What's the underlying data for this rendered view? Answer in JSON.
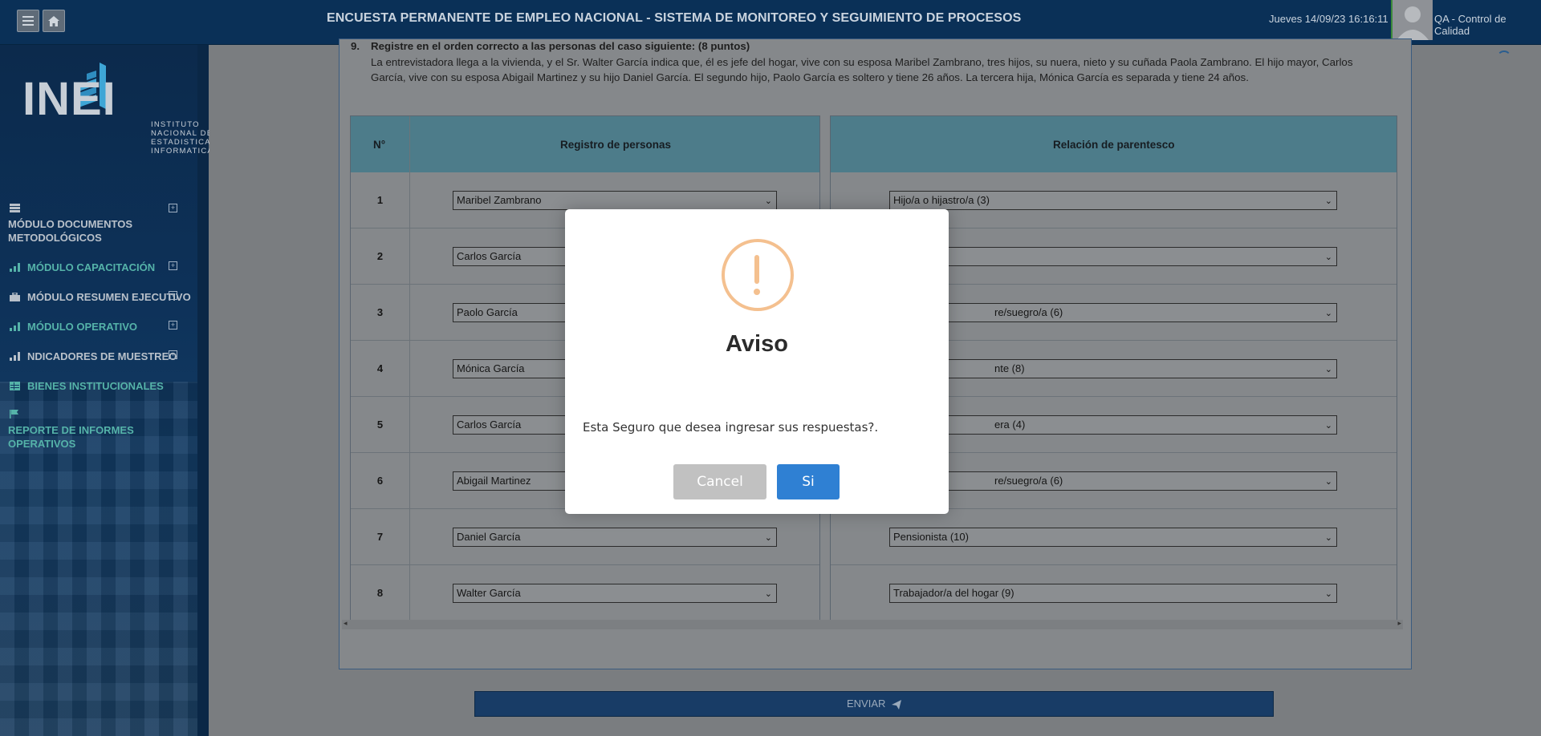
{
  "header": {
    "title": "ENCUESTA PERMANENTE DE EMPLEO NACIONAL - SISTEMA DE MONITOREO Y SEGUIMIENTO DE PROCESOS",
    "datetime": "Jueves 14/09/23 16:16:11",
    "user": "QA - Control de Calidad",
    "menu_icon": "hamburger-icon",
    "home_icon": "home-icon"
  },
  "logo": {
    "word": "INEI",
    "sub": [
      "INSTITUTO",
      "NACIONAL DE",
      "ESTADISTICA E",
      "INFORMATICA"
    ]
  },
  "sidebar": {
    "items": [
      {
        "label_line1": "MÓDULO DOCUMENTOS",
        "label_line2": "METODOLÓGICOS",
        "icon": "database-icon"
      },
      {
        "label": "MÓDULO CAPACITACIÓN",
        "icon": "bar-chart-icon"
      },
      {
        "label": "MÓDULO RESUMEN EJECUTIVO",
        "icon": "briefcase-icon"
      },
      {
        "label": "MÓDULO OPERATIVO",
        "icon": "bar-chart-icon"
      },
      {
        "label": "NDICADORES DE MUESTREO",
        "icon": "bar-chart-icon"
      },
      {
        "label": "BIENES INSTITUCIONALES",
        "icon": "table-icon"
      },
      {
        "label_line1": "REPORTE DE INFORMES",
        "label_line2": "OPERATIVOS",
        "icon": "flag-icon"
      }
    ]
  },
  "question": {
    "number": "9.",
    "title": "Registre en el orden correcto a las personas del caso siguiente: (8 puntos)",
    "body": "La entrevistadora llega a la vivienda, y el Sr. Walter García indica que, él es jefe del hogar, vive con su esposa Maribel Zambrano, tres hijos, su nuera, nieto y su cuñada Paola Zambrano. El hijo mayor, Carlos García, vive con su esposa Abigail Martinez y su hijo Daniel García. El segundo hijo, Paolo García es soltero y tiene 26 años. La tercera hija, Mónica García es separada y tiene 24 años."
  },
  "table_left": {
    "col_num": "N°",
    "col_name": "Registro de personas",
    "rows": [
      {
        "n": "1",
        "value": "Maribel Zambrano"
      },
      {
        "n": "2",
        "value": "Carlos García"
      },
      {
        "n": "3",
        "value": "Paolo García"
      },
      {
        "n": "4",
        "value": "Mónica García"
      },
      {
        "n": "5",
        "value": "Carlos García"
      },
      {
        "n": "6",
        "value": "Abigail Martinez"
      },
      {
        "n": "7",
        "value": "Daniel García"
      },
      {
        "n": "8",
        "value": "Walter García"
      }
    ]
  },
  "table_right": {
    "col_name": "Relación de parentesco",
    "rows": [
      "Hijo/a o hijastro/a (3)",
      "",
      "re/suegro/a (6)",
      "nte (8)",
      "era (4)",
      "re/suegro/a (6)",
      "Pensionista (10)",
      "Trabajador/a del hogar (9)"
    ]
  },
  "submit": {
    "label": "ENVIAR",
    "icon": "paper-plane-icon"
  },
  "modal": {
    "icon": "warning-icon",
    "title": "Aviso",
    "message": "Esta Seguro que desea ingresar sus respuestas?.",
    "cancel_label": "Cancel",
    "confirm_label": "Si",
    "colors": {
      "confirm": "#2f80d3",
      "cancel": "#c1c1c1",
      "warning": "#f4c08f"
    }
  }
}
